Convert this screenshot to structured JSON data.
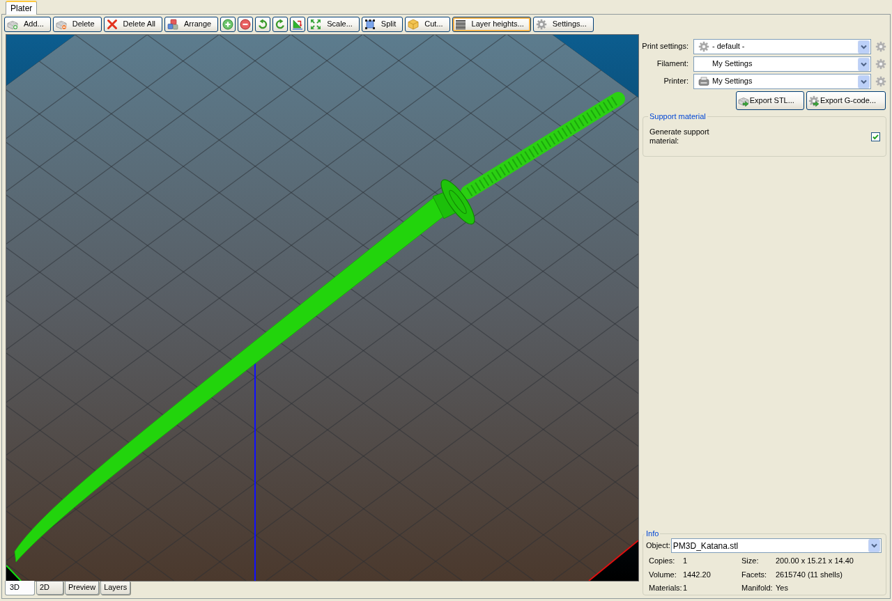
{
  "tabs": [
    {
      "label": "Plater",
      "selected": true
    }
  ],
  "toolbar": [
    {
      "kind": "text",
      "label": "Add...",
      "focused": false
    },
    {
      "kind": "text",
      "label": "Delete",
      "focused": false
    },
    {
      "kind": "text",
      "label": "Delete All",
      "focused": false
    },
    {
      "kind": "text",
      "label": "Arrange",
      "focused": false
    },
    {
      "kind": "icon",
      "focused": false
    },
    {
      "kind": "icon",
      "focused": false
    },
    {
      "kind": "icon",
      "focused": false
    },
    {
      "kind": "icon",
      "focused": false
    },
    {
      "kind": "icon",
      "focused": false
    },
    {
      "kind": "text",
      "label": "Scale...",
      "focused": false
    },
    {
      "kind": "text",
      "label": "Split",
      "focused": false
    },
    {
      "kind": "text",
      "label": "Cut...",
      "focused": false
    },
    {
      "kind": "text",
      "label": "Layer heights...",
      "focused": true
    },
    {
      "kind": "text",
      "label": "Settings...",
      "focused": false
    }
  ],
  "view_tabs": [
    {
      "label": "3D",
      "selected": true
    },
    {
      "label": "2D",
      "selected": false
    },
    {
      "label": "Preview",
      "selected": false
    },
    {
      "label": "Layers",
      "selected": false
    }
  ],
  "presets": [
    {
      "label": "Print settings:",
      "value": "- default -"
    },
    {
      "label": "Filament:",
      "value": "My Settings"
    },
    {
      "label": "Printer:",
      "value": "My Settings"
    }
  ],
  "export_buttons": [
    {
      "label": "Export STL..."
    },
    {
      "label": "Export G-code..."
    }
  ],
  "support_material": {
    "title": "Support material",
    "options": [
      {
        "label": "Generate support material:",
        "checked": true
      }
    ]
  },
  "info": {
    "title": "Info",
    "object": {
      "label": "Object:",
      "value": "PM3D_Katana.stl"
    },
    "fields": [
      {
        "label": "Copies:",
        "value": "1"
      },
      {
        "label": "Size:",
        "value": "200.00 x 15.21 x 14.40"
      },
      {
        "label": "Volume:",
        "value": "1442.20"
      },
      {
        "label": "Facets:",
        "value": "2615740 (11 shells)"
      },
      {
        "label": "Materials:",
        "value": "1"
      },
      {
        "label": "Manifold:",
        "value": "Yes"
      }
    ]
  }
}
